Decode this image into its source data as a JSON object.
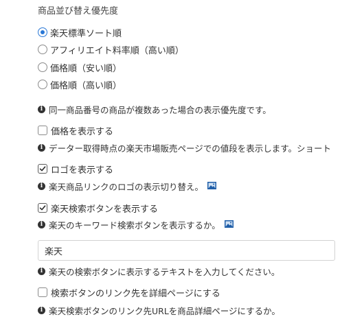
{
  "sort_priority": {
    "title": "商品並び替え優先度",
    "options": [
      {
        "label": "楽天標準ソート順",
        "checked": true
      },
      {
        "label": "アフィリエイト料率順（高い順）",
        "checked": false
      },
      {
        "label": "価格順（安い順）",
        "checked": false
      },
      {
        "label": "価格順（高い順）",
        "checked": false
      }
    ],
    "help": "同一商品番号の商品が複数あった場合の表示優先度です。"
  },
  "show_price": {
    "label": "価格を表示する",
    "checked": false,
    "help": "データー取得時点の楽天市場販売ページでの値段を表示します。ショート"
  },
  "show_logo": {
    "label": "ロゴを表示する",
    "checked": true,
    "help": "楽天商品リンクのロゴの表示切り替え。"
  },
  "show_search_button": {
    "label": "楽天検索ボタンを表示する",
    "checked": true,
    "help": "楽天のキーワード検索ボタンを表示するか。"
  },
  "search_button_text": {
    "value": "楽天",
    "help": "楽天の検索ボタンに表示するテキストを入力してください。"
  },
  "search_link_detail": {
    "label": "検索ボタンのリンク先を詳細ページにする",
    "checked": false,
    "help": "楽天検索ボタンのリンク先URLを商品詳細ページにするか。"
  },
  "colors": {
    "accent": "#2a78d6",
    "text": "#333333",
    "border": "#d2d2d2"
  }
}
